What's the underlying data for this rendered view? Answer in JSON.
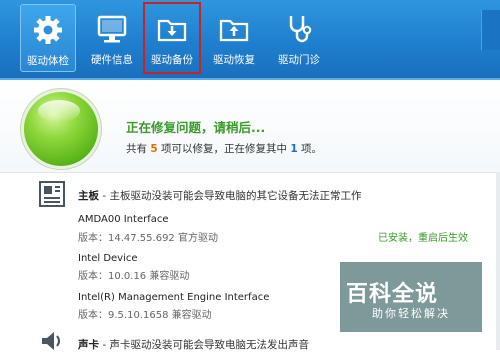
{
  "toolbar": {
    "buttons": [
      {
        "label": "驱动体检",
        "icon": "gear-icon",
        "active": true
      },
      {
        "label": "硬件信息",
        "icon": "monitor-icon"
      },
      {
        "label": "驱动备份",
        "icon": "folder-download-icon",
        "highlighted": true
      },
      {
        "label": "驱动恢复",
        "icon": "folder-upload-icon"
      },
      {
        "label": "驱动门诊",
        "icon": "stethoscope-icon"
      }
    ]
  },
  "status": {
    "title": "正在修复问题，请稍后...",
    "line_prefix": "共有 ",
    "total": "5",
    "line_middle": " 项可以修复，正在修复其中 ",
    "current": "1",
    "line_suffix": " 项。"
  },
  "categories": [
    {
      "name": "主板",
      "description": " - 主板驱动没装可能会导致电脑的其它设备无法正常工作",
      "icon": "motherboard-icon",
      "devices": [
        {
          "name": "AMDA00 Interface",
          "version": "版本：14.47.55.692 官方驱动",
          "status": "已安装，重启后生效"
        },
        {
          "name": "Intel Device",
          "version": "版本：10.0.16 兼容驱动",
          "status": ""
        },
        {
          "name": "Intel(R) Management Engine Interface",
          "version": "版本：9.5.10.1658 兼容驱动",
          "status": ""
        }
      ]
    },
    {
      "name": "声卡",
      "description": " - 声卡驱动没装可能会导致电脑无法发出声音",
      "icon": "speaker-icon",
      "devices": []
    }
  ],
  "watermark": {
    "title": "百科全说",
    "subtitle": "助你轻松解决"
  },
  "colors": {
    "toolbar_blue": "#1f7fcf",
    "status_green": "#3a9a2a",
    "count_orange": "#e46f00",
    "count_blue": "#1a6fbd",
    "highlight_red": "#cc2222"
  }
}
